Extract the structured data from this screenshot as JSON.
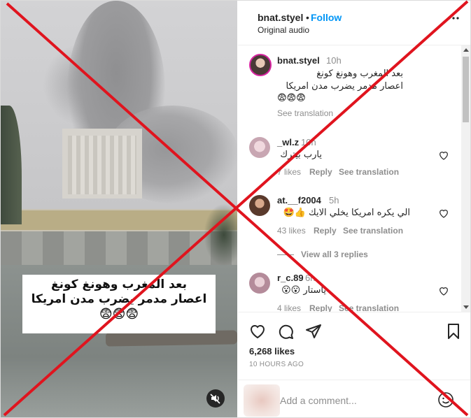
{
  "header": {
    "username": "bnat.styel",
    "separator": "•",
    "follow_label": "Follow",
    "audio": "Original audio",
    "more_icon": "more-horizontal-icon"
  },
  "video": {
    "caption_line1": "بعد المغرب وهونغ كونغ",
    "caption_line2": "اعصار مدمر يضرب مدن امريكا",
    "caption_line3": "😨😨😨",
    "mute_icon": "muted-speaker-icon"
  },
  "post": {
    "username": "bnat.styel",
    "time": "10h",
    "line1": "بعد المغرب وهونغ كونغ",
    "line2": "اعصار مدمر يضرب مدن امريكا",
    "line3": "😨😨😨",
    "see_translation": "See translation"
  },
  "comments": [
    {
      "username": "_wl.z",
      "time": "10h",
      "text": "يارب بيترك",
      "likes": "7 likes",
      "reply": "Reply",
      "see_translation": "See translation"
    },
    {
      "username": "at.__f2004",
      "time": "5h",
      "text": "الي يكره امريكا يخلي الايك 👍🤩",
      "likes": "43 likes",
      "reply": "Reply",
      "see_translation": "See translation",
      "view_replies": "View all 3 replies"
    },
    {
      "username": "r_c.89",
      "time": "6h",
      "text": "ياستار 😮😮",
      "likes": "4 likes",
      "reply": "Reply",
      "see_translation": "See translation"
    }
  ],
  "actions": {
    "like_icon": "heart-icon",
    "comment_icon": "comment-bubble-icon",
    "share_icon": "paper-plane-icon",
    "save_icon": "bookmark-icon",
    "likes_count": "6,268 likes",
    "timestamp": "10 HOURS AGO"
  },
  "add_comment": {
    "placeholder": "Add a comment...",
    "emoji_icon": "emoji-smiley-icon"
  },
  "overlay": {
    "mark": "false-rating-cross",
    "color": "#e0141e"
  }
}
